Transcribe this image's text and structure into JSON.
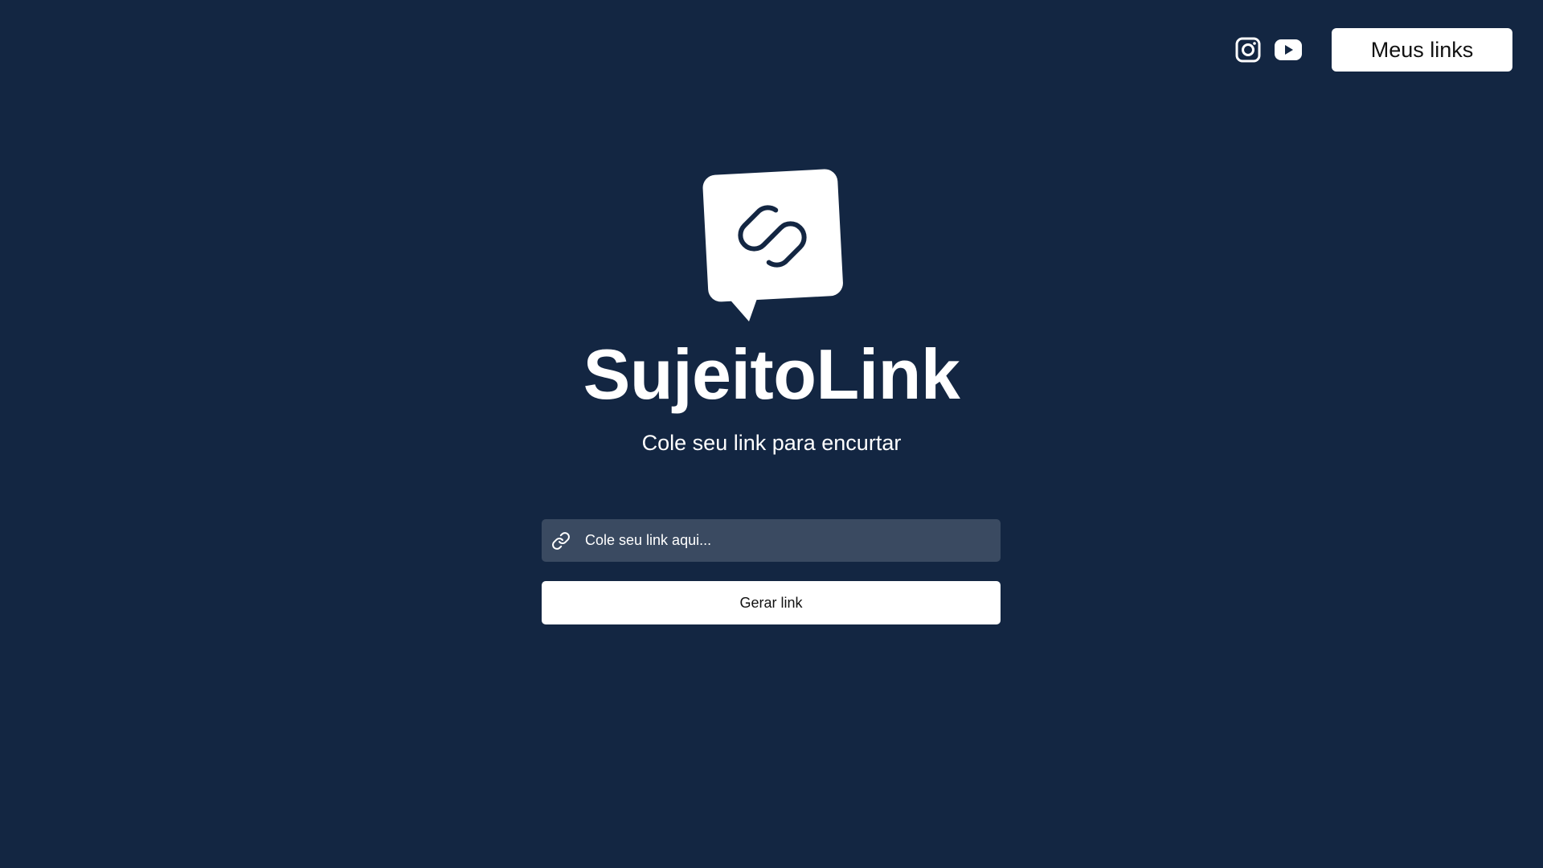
{
  "header": {
    "social": [
      {
        "name": "instagram",
        "icon": "instagram-icon"
      },
      {
        "name": "youtube",
        "icon": "youtube-icon"
      }
    ],
    "my_links_label": "Meus links"
  },
  "hero": {
    "logo_icon": "link-chat-bubble-icon",
    "title": "SujeitoLink",
    "subtitle": "Cole seu link para encurtar"
  },
  "form": {
    "input_icon": "link-icon",
    "input_placeholder": "Cole seu link aqui...",
    "input_value": "",
    "submit_label": "Gerar link"
  },
  "colors": {
    "background": "#132642",
    "input_background": "#3a4a61",
    "button_background": "#ffffff",
    "text": "#ffffff"
  }
}
